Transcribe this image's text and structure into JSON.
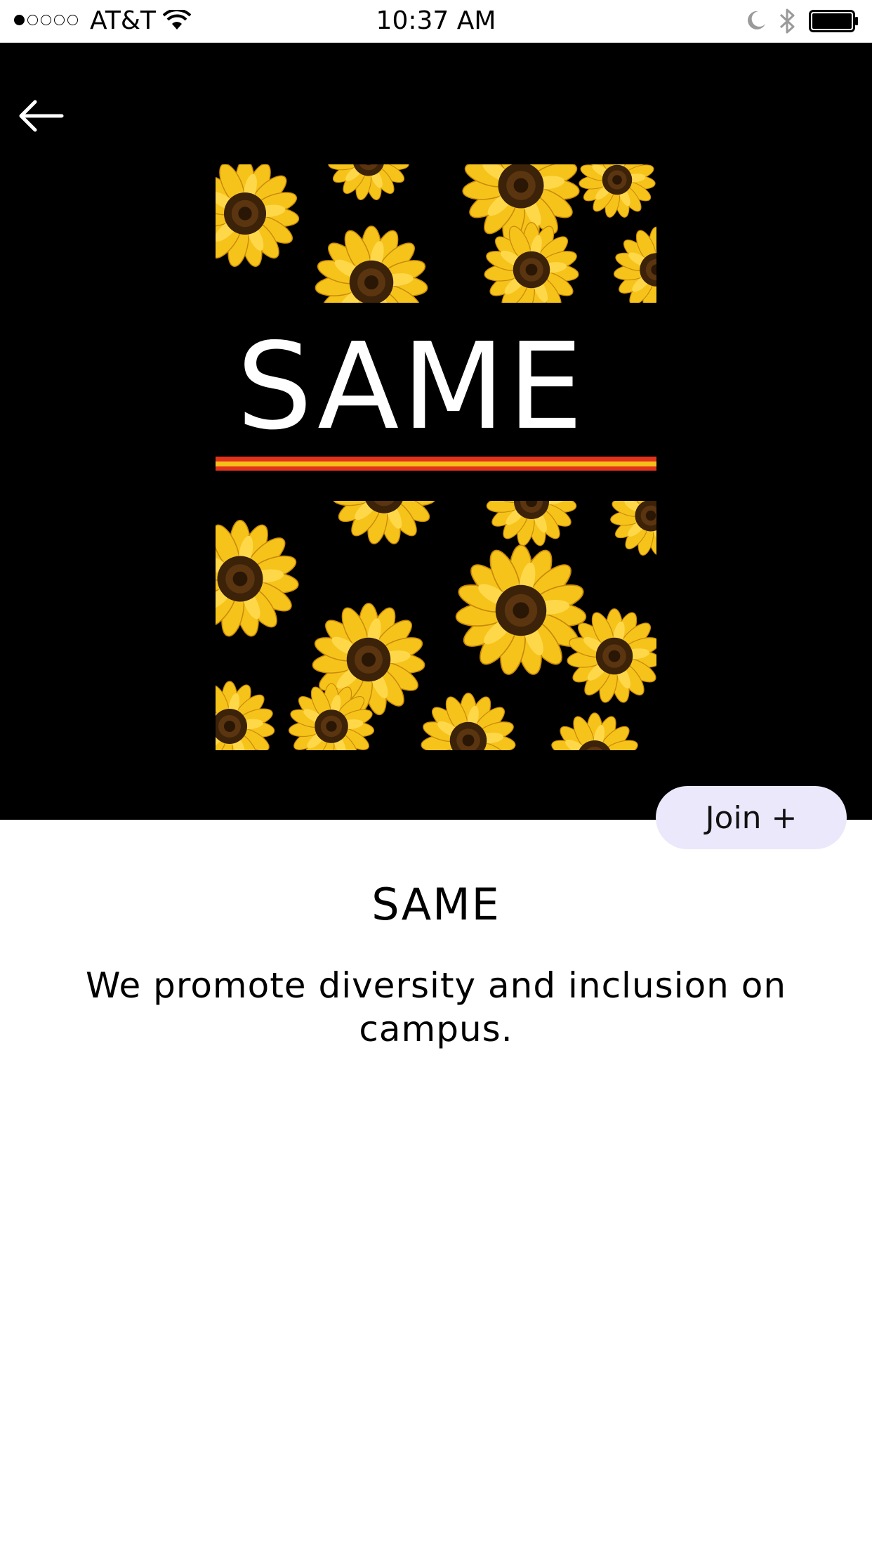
{
  "status_bar": {
    "carrier": "AT&T",
    "time": "10:37 AM",
    "signal_bars_filled": 1,
    "signal_bars_total": 5
  },
  "header": {
    "back_icon": "arrow-left-icon"
  },
  "cover": {
    "word": "SAME",
    "pattern": "sunflowers",
    "stripe_colors": [
      "#e2321d",
      "#f5c118"
    ]
  },
  "actions": {
    "join_label": "Join +"
  },
  "club": {
    "name": "SAME",
    "description": "We promote diversity and inclusion on campus."
  },
  "colors": {
    "hero_background": "#000000",
    "join_button_background": "#ebe8fb",
    "sunflower_petal": "#f6c31b",
    "sunflower_center": "#3b2208"
  }
}
